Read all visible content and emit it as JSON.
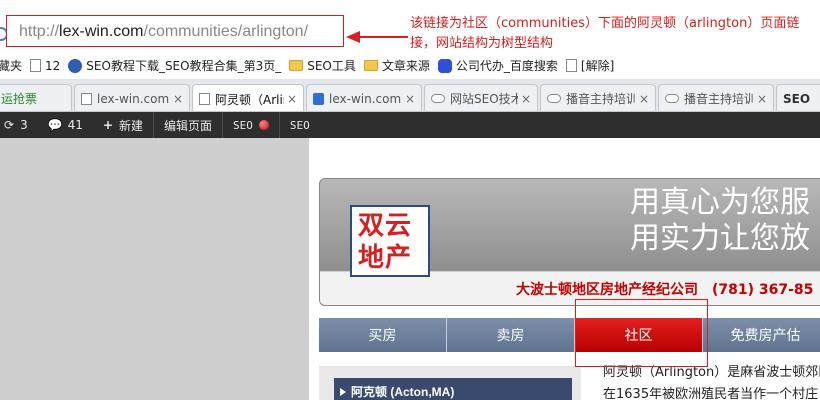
{
  "address_bar": {
    "url_prefix": "http://",
    "url_domain": "lex-win.com",
    "url_path": "/communities/arlington/"
  },
  "annotation": {
    "text": "该链接为社区（communities）下面的阿灵顿（arlington）页面链接，网站结构为树型结构"
  },
  "bookmarks": [
    {
      "label": "藏夹",
      "icon": "folder-icon"
    },
    {
      "label": "12",
      "icon": "page-icon"
    },
    {
      "label": "SEO教程下载_SEO教程合集_第3页_",
      "icon": "m-logo-icon"
    },
    {
      "label": "SEO工具",
      "icon": "folder-icon"
    },
    {
      "label": "文章来源",
      "icon": "folder-icon"
    },
    {
      "label": "公司代办_百度搜索",
      "icon": "baidu-paw-icon"
    },
    {
      "label": "[解除]",
      "icon": "page-icon"
    }
  ],
  "tabs": [
    {
      "label": "运抢票",
      "icon": "",
      "close": ""
    },
    {
      "label": "lex-win.com",
      "icon": "page-icon",
      "close": "×"
    },
    {
      "label": "阿灵顿（Arlington）",
      "icon": "page-icon",
      "close": "×"
    },
    {
      "label": "lex-win.com",
      "icon": "blue-page-icon",
      "close": "×"
    },
    {
      "label": "网站SEO技术",
      "icon": "cloud-icon",
      "close": "×"
    },
    {
      "label": "播音主持培训",
      "icon": "cloud-icon",
      "close": "×"
    },
    {
      "label": "播音主持培训",
      "icon": "cloud-icon",
      "close": "×"
    },
    {
      "label": "SEO",
      "icon": "seo-icon",
      "close": ""
    }
  ],
  "toolbar": {
    "refresh_count": "3",
    "comment_count": "41",
    "new_label": "新建",
    "edit_label": "编辑页面",
    "seo_label": "SEO",
    "seo2_label": "SEO"
  },
  "site": {
    "logo_line1": "双云",
    "logo_line2": "地产",
    "slogan_line1": "用真心为您服",
    "slogan_line2": "用实力让您放",
    "company": "大波士顿地区房地产经纪公司　(781) 367-85",
    "nav": [
      "买房",
      "卖房",
      "社区",
      "免费房产估"
    ],
    "nav_active_index": 2,
    "sidebar_item": "阿克顿 (Acton,MA)",
    "content_line1": "阿灵顿（Arlington）是麻省波士顿郊区",
    "content_line2": "在1635年被欧洲殖民者当作一个村庄"
  },
  "colors": {
    "annotation_red": "#d81e1e",
    "nav_active": "#d00000",
    "nav_default": "#6d809d",
    "toolbar_bg": "#2e2e2e"
  }
}
